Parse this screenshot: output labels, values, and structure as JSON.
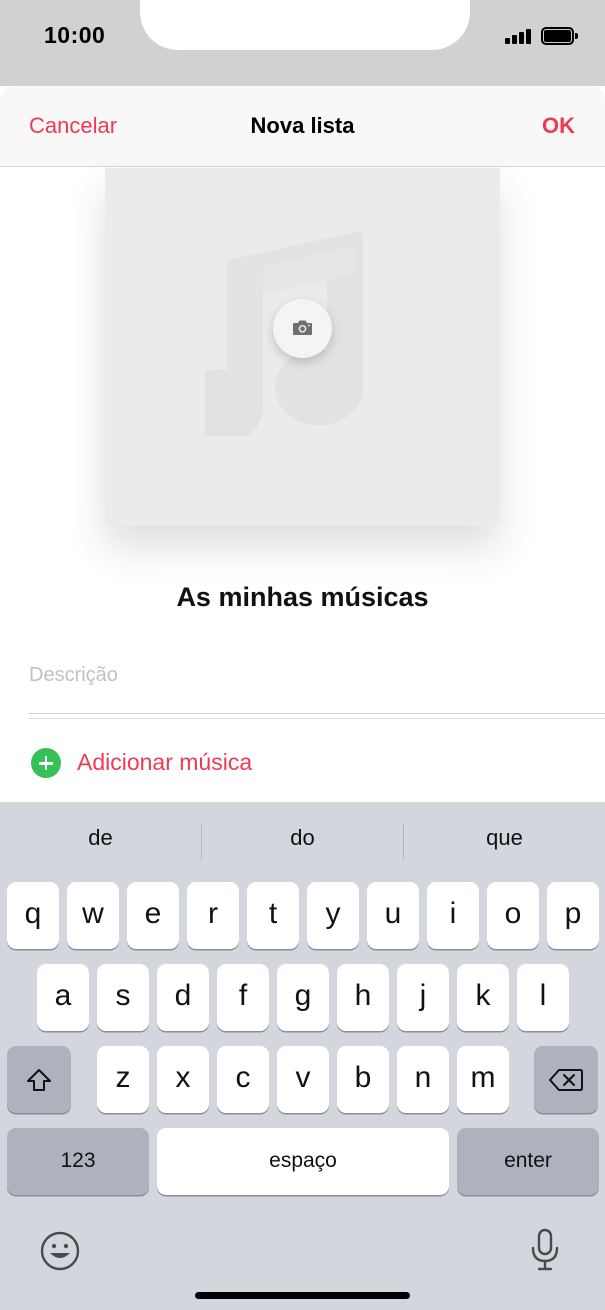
{
  "status_bar": {
    "time": "10:00",
    "icons": [
      "signal-icon",
      "battery-icon"
    ]
  },
  "nav": {
    "cancel": "Cancelar",
    "title": "Nova lista",
    "ok": "OK"
  },
  "artwork": {
    "icons": [
      "music-note-icon",
      "camera-icon"
    ]
  },
  "playlist": {
    "title": "As minhas músicas",
    "description_placeholder": "Descrição",
    "description_value": ""
  },
  "add_music": {
    "label": "Adicionar música",
    "icon": "add-circle-icon"
  },
  "keyboard": {
    "suggestions": [
      "de",
      "do",
      "que"
    ],
    "row1": [
      "q",
      "w",
      "e",
      "r",
      "t",
      "y",
      "u",
      "i",
      "o",
      "p"
    ],
    "row2": [
      "a",
      "s",
      "d",
      "f",
      "g",
      "h",
      "j",
      "k",
      "l"
    ],
    "row3": [
      "z",
      "x",
      "c",
      "v",
      "b",
      "n",
      "m"
    ],
    "numbers_key": "123",
    "space_key": "espaço",
    "enter_key": "enter",
    "icons": [
      "shift-icon",
      "backspace-icon",
      "emoji-icon",
      "microphone-icon"
    ]
  },
  "colors": {
    "accent": "#f03a52",
    "add_green": "#33c158",
    "keyboard_bg": "#d3d6dd",
    "status_bar_bg": "#d1d1d1"
  }
}
